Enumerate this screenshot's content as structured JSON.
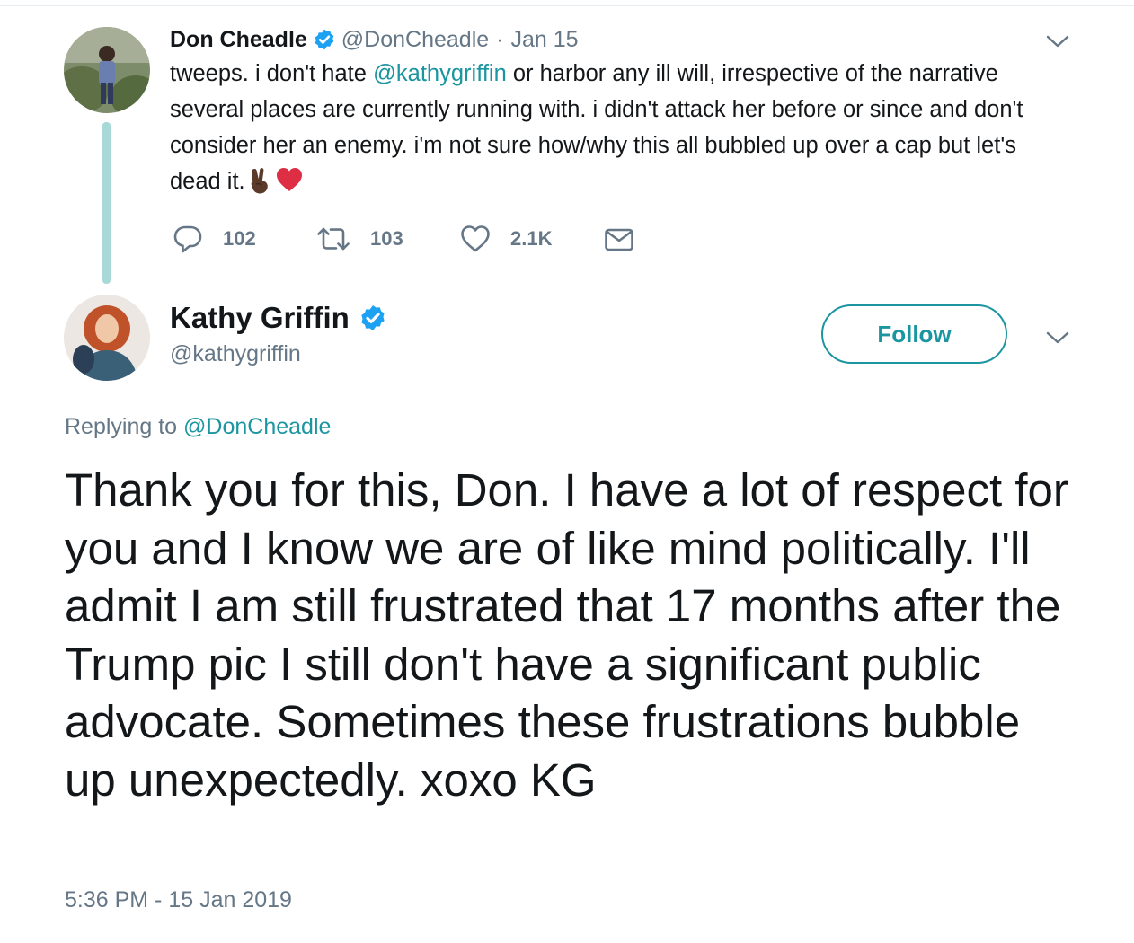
{
  "parent_tweet": {
    "display_name": "Don Cheadle",
    "handle": "@DonCheadle",
    "separator": "·",
    "date": "Jan 15",
    "text_before_mention": "tweeps. i don't hate ",
    "mention": "@kathygriffin",
    "text_after_mention": " or harbor any ill will, irrespective of the narrative several places are currently running with. i didn't attack her before or since and don't consider her an enemy. i'm not sure how/why this all bubbled up over a cap but let's dead it.",
    "emojis": [
      "victory-hand",
      "red-heart"
    ],
    "actions": {
      "reply_count": "102",
      "retweet_count": "103",
      "like_count": "2.1K"
    }
  },
  "reply_tweet": {
    "display_name": "Kathy Griffin",
    "handle": "@kathygriffin",
    "follow_label": "Follow",
    "replying_prefix": "Replying to",
    "replying_to": "@DonCheadle",
    "text": "Thank you for this, Don. I have a lot of respect for you and I know we are of like mind politically. I'll admit I am still frustrated that 17 months after the Trump pic I still don't have a significant public advocate. Sometimes these frustrations bubble up unexpectedly. xoxo KG",
    "timestamp": "5:36 PM - 15 Jan 2019"
  },
  "colors": {
    "accent": "#1b95a0",
    "verified_blue": "#1da1f2",
    "muted_text": "#657786",
    "thread_line": "#a8d8d8",
    "heart_red": "#e0245e"
  },
  "icons": {
    "verified": "verified-badge-icon",
    "chevron": "chevron-down-icon",
    "reply": "reply-icon",
    "retweet": "retweet-icon",
    "like": "heart-icon",
    "dm": "envelope-icon"
  }
}
